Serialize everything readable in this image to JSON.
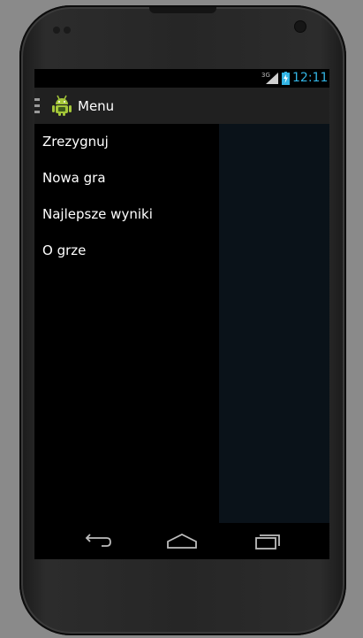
{
  "status_bar": {
    "network_label": "3G",
    "time": "12:11",
    "icons": [
      "signal-icon",
      "battery-charging-icon"
    ],
    "time_color": "#33b5e5"
  },
  "action_bar": {
    "title": "Menu",
    "icons": [
      "drawer-indicator-icon",
      "android-app-icon"
    ]
  },
  "menu": {
    "items": [
      {
        "label": "Zrezygnuj"
      },
      {
        "label": "Nowa gra"
      },
      {
        "label": "Najlepsze wyniki"
      },
      {
        "label": "O grze"
      }
    ]
  },
  "nav_bar": {
    "icons": [
      "back-icon",
      "home-icon",
      "recent-apps-icon"
    ]
  },
  "colors": {
    "panel_background": "#0a1219",
    "action_bar_background": "#202020",
    "device_frame": "#262626",
    "emulator_background": "#8a8a8a"
  }
}
